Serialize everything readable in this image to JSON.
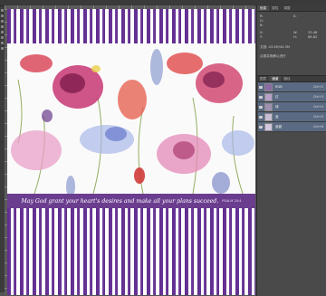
{
  "canvas": {
    "verse": "May God grant your heart's desires and make all your plans succeed.",
    "reference": "PSALM 20:4"
  },
  "panel": {
    "tabs": [
      "信息",
      "属性",
      "调整"
    ],
    "info": {
      "r": "R:",
      "g": "G:",
      "b": "B:",
      "k": "K:",
      "x": "X:",
      "y": "Y:",
      "w": "W:",
      "h": "H:",
      "xv": "33.48",
      "yv": "68.82",
      "doc": "文档: 43.5M/43.5M",
      "hint": "点按并拖移以进行"
    },
    "layer_tabs": [
      "图层",
      "通道",
      "路径"
    ],
    "layers": [
      {
        "name": "RGB",
        "shortcut": "Ctrl+2",
        "thumb": "#8a6aa2"
      },
      {
        "name": "红",
        "shortcut": "Ctrl+3",
        "thumb": "#b8a0c8"
      },
      {
        "name": "绿",
        "shortcut": "Ctrl+4",
        "thumb": "#9f8fb0"
      },
      {
        "name": "蓝",
        "shortcut": "Ctrl+5",
        "thumb": "#c9bdd6"
      },
      {
        "name": "蓝副",
        "shortcut": "Ctrl+6",
        "thumb": "#d2c6de"
      }
    ]
  },
  "colors": {
    "purple": "#6b3d8f",
    "stripe": "#5f2c8c"
  }
}
